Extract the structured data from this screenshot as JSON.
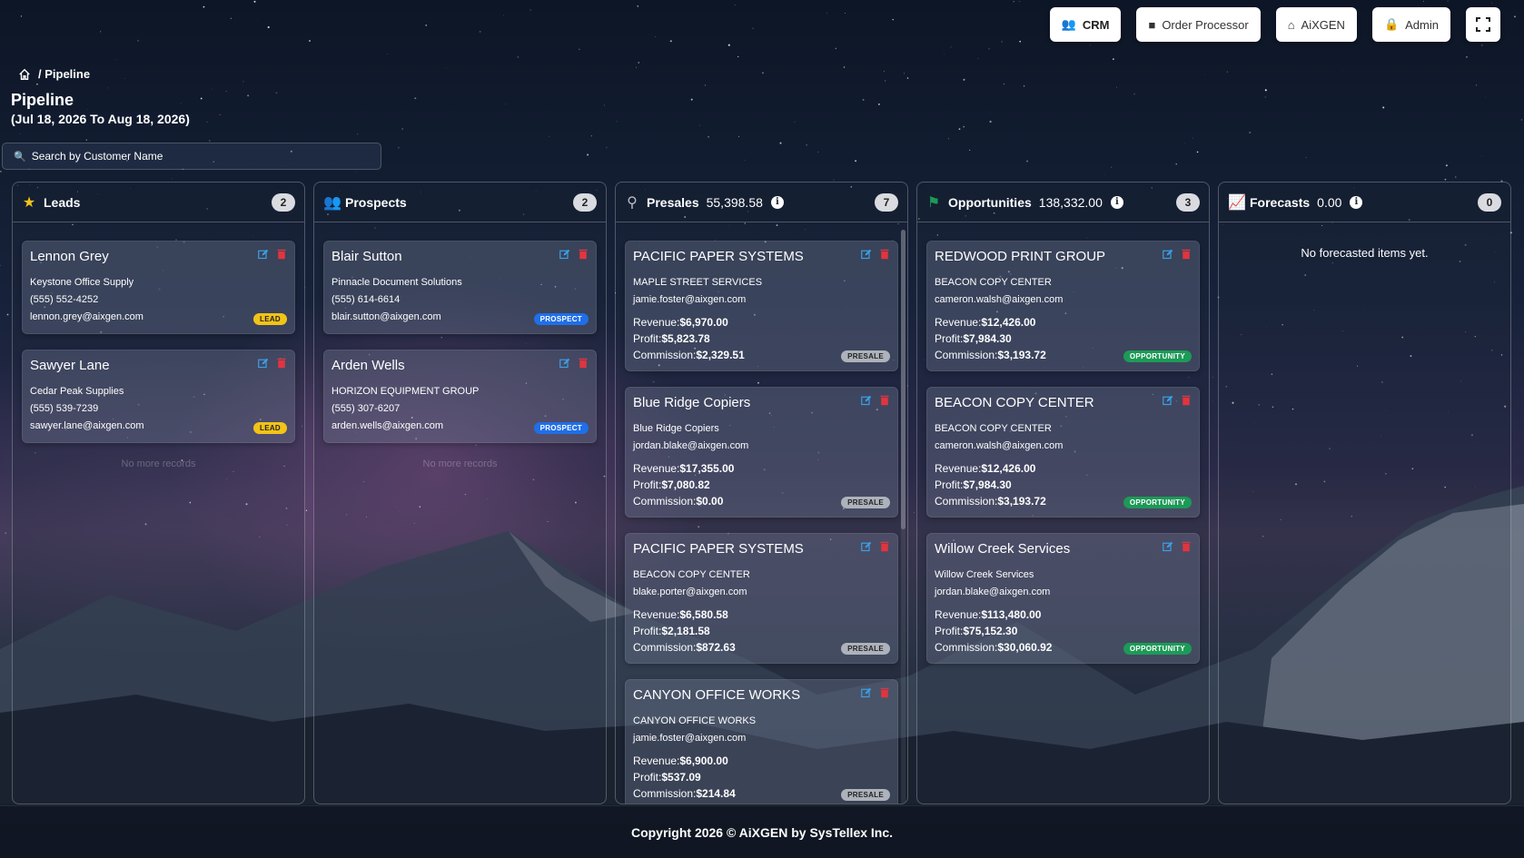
{
  "nav": {
    "crm": "CRM",
    "order_processor": "Order Processor",
    "aixgen": "AiXGEN",
    "admin": "Admin"
  },
  "breadcrumb": {
    "current": "/ Pipeline"
  },
  "page": {
    "title": "Pipeline",
    "subtitle": "(Jul 18, 2026 To Aug 18, 2026)"
  },
  "search": {
    "placeholder": "Search by Customer Name"
  },
  "columns": {
    "leads": {
      "title": "Leads",
      "count": "2",
      "no_more": "No more records",
      "cards": [
        {
          "name": "Lennon Grey",
          "company": "Keystone Office Supply",
          "phone": "(555) 552-4252",
          "email": "lennon.grey@aixgen.com",
          "tag": "LEAD"
        },
        {
          "name": "Sawyer Lane",
          "company": "Cedar Peak Supplies",
          "phone": "(555) 539-7239",
          "email": "sawyer.lane@aixgen.com",
          "tag": "LEAD"
        }
      ]
    },
    "prospects": {
      "title": "Prospects",
      "count": "2",
      "no_more": "No more records",
      "cards": [
        {
          "name": "Blair Sutton",
          "company": "Pinnacle Document Solutions",
          "phone": "(555) 614-6614",
          "email": "blair.sutton@aixgen.com",
          "tag": "PROSPECT"
        },
        {
          "name": "Arden Wells",
          "company": "HORIZON EQUIPMENT GROUP",
          "phone": "(555) 307-6207",
          "email": "arden.wells@aixgen.com",
          "tag": "PROSPECT"
        }
      ]
    },
    "presales": {
      "title": "Presales",
      "amount": "55,398.58",
      "count": "7",
      "cards": [
        {
          "name": "PACIFIC PAPER SYSTEMS",
          "company": "MAPLE STREET SERVICES",
          "email": "jamie.foster@aixgen.com",
          "revenue": "$6,970.00",
          "profit": "$5,823.78",
          "commission": "$2,329.51",
          "tag": "PRESALE"
        },
        {
          "name": "Blue Ridge Copiers",
          "company": "Blue Ridge Copiers",
          "email": "jordan.blake@aixgen.com",
          "revenue": "$17,355.00",
          "profit": "$7,080.82",
          "commission": "$0.00",
          "tag": "PRESALE"
        },
        {
          "name": "PACIFIC PAPER SYSTEMS",
          "company": "BEACON COPY CENTER",
          "email": "blake.porter@aixgen.com",
          "revenue": "$6,580.58",
          "profit": "$2,181.58",
          "commission": "$872.63",
          "tag": "PRESALE"
        },
        {
          "name": "CANYON OFFICE WORKS",
          "company": "CANYON OFFICE WORKS",
          "email": "jamie.foster@aixgen.com",
          "revenue": "$6,900.00",
          "profit": "$537.09",
          "commission": "$214.84",
          "tag": "PRESALE"
        }
      ]
    },
    "opportunities": {
      "title": "Opportunities",
      "amount": "138,332.00",
      "count": "3",
      "cards": [
        {
          "name": "REDWOOD PRINT GROUP",
          "company": "BEACON COPY CENTER",
          "email": "cameron.walsh@aixgen.com",
          "revenue": "$12,426.00",
          "profit": "$7,984.30",
          "commission": "$3,193.72",
          "tag": "OPPORTUNITY"
        },
        {
          "name": "BEACON COPY CENTER",
          "company": "BEACON COPY CENTER",
          "email": "cameron.walsh@aixgen.com",
          "revenue": "$12,426.00",
          "profit": "$7,984.30",
          "commission": "$3,193.72",
          "tag": "OPPORTUNITY"
        },
        {
          "name": "Willow Creek Services",
          "company": "Willow Creek Services",
          "email": "jordan.blake@aixgen.com",
          "revenue": "$113,480.00",
          "profit": "$75,152.30",
          "commission": "$30,060.92",
          "tag": "OPPORTUNITY"
        }
      ]
    },
    "forecasts": {
      "title": "Forecasts",
      "amount": "0.00",
      "count": "0",
      "empty": "No forecasted items yet."
    }
  },
  "labels": {
    "revenue": "Revenue:",
    "profit": "Profit:",
    "commission": "Commission:"
  },
  "footer": {
    "text": "Copyright 2026 © AiXGEN by SysTellex Inc."
  },
  "colors": {
    "lead_tag": "#f2c318",
    "prospect_tag": "#1f6fe8",
    "presale_tag": "#adb2bb",
    "opportunity_tag": "#1d9a57",
    "edit_icon": "#3aa0e6",
    "delete_icon": "#e0353f"
  }
}
